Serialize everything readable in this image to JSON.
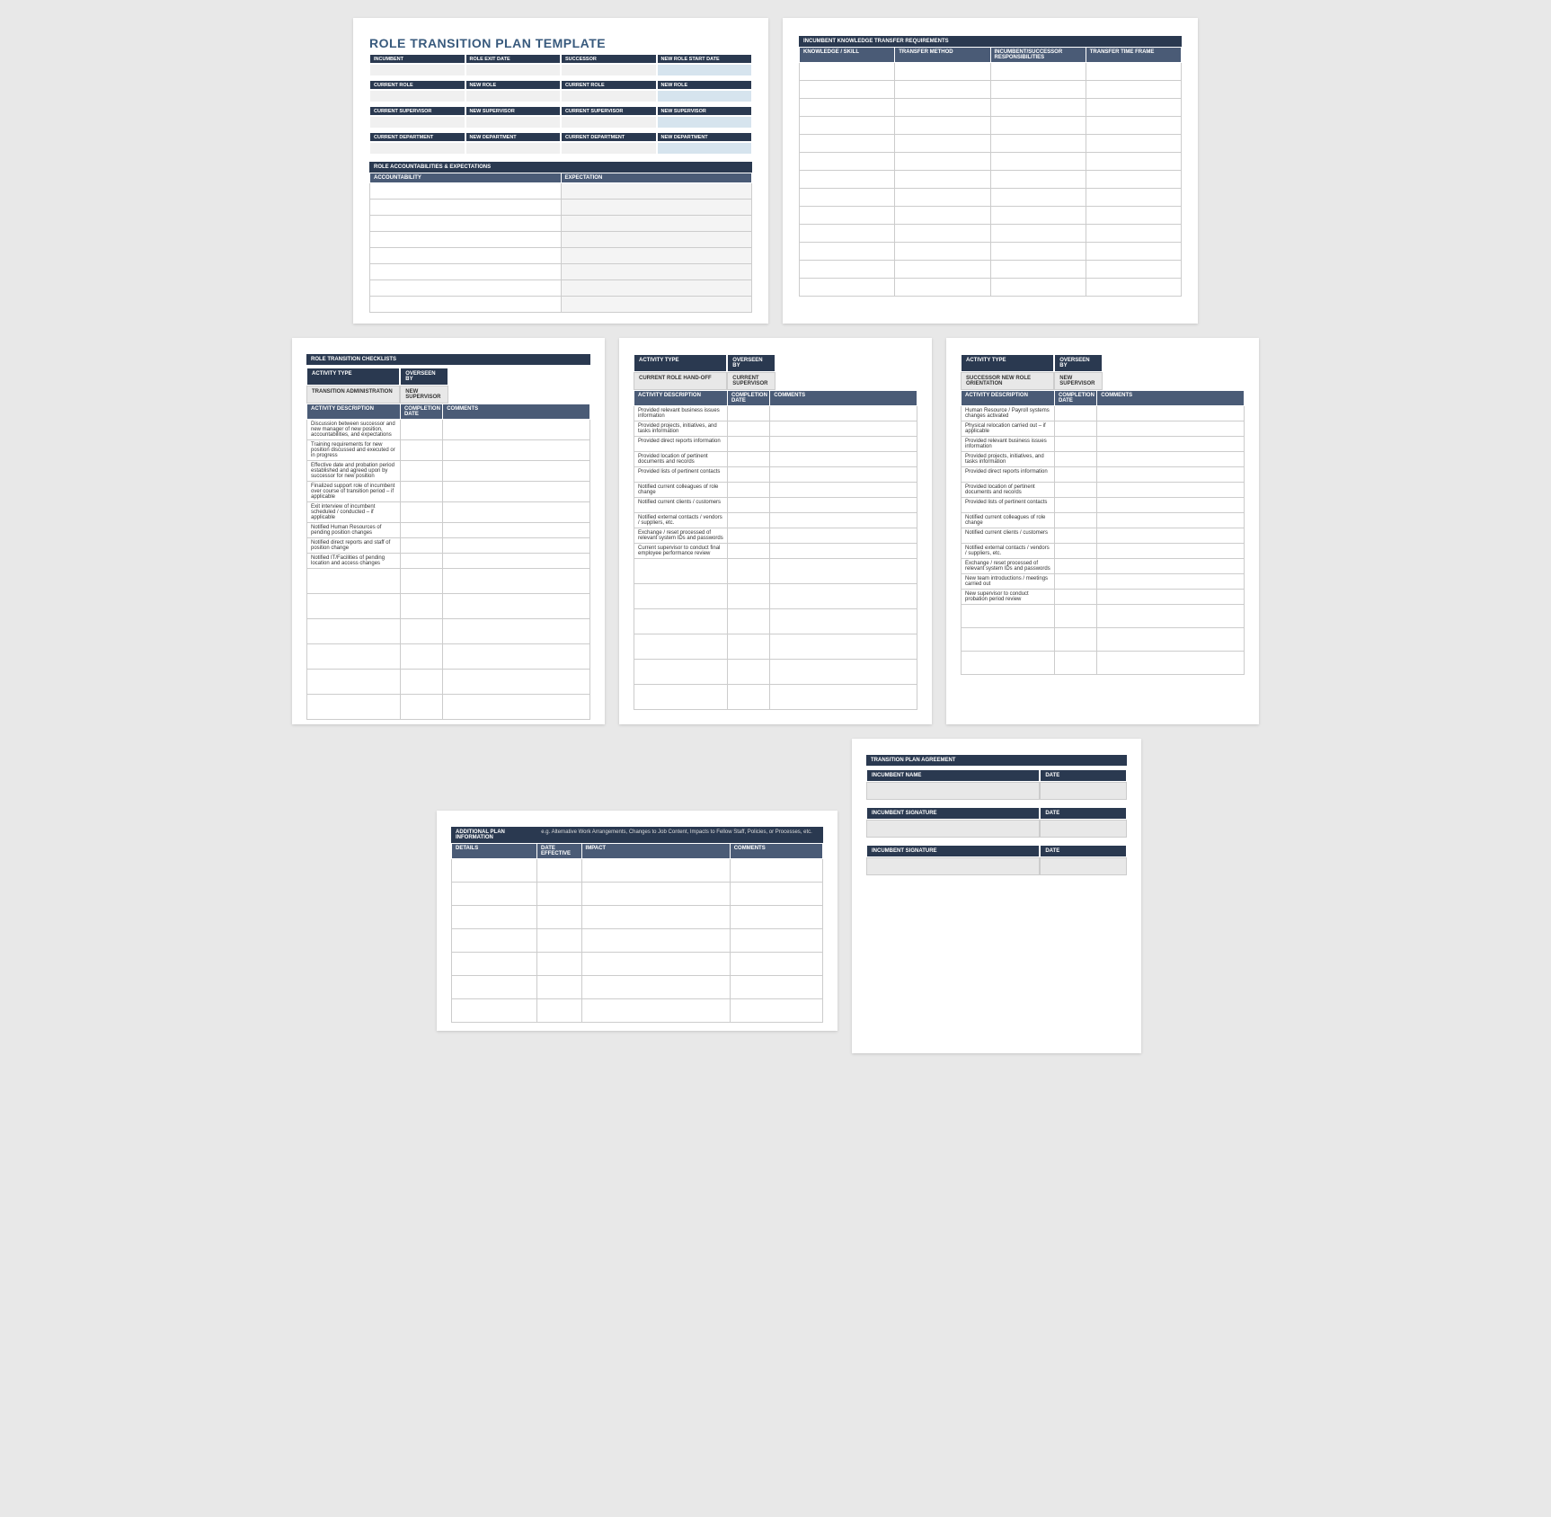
{
  "page1": {
    "title": "ROLE TRANSITION PLAN TEMPLATE",
    "r1": [
      "INCUMBENT",
      "ROLE EXIT DATE",
      "SUCCESSOR",
      "NEW ROLE START DATE"
    ],
    "r2": [
      "CURRENT ROLE",
      "NEW ROLE",
      "CURRENT ROLE",
      "NEW ROLE"
    ],
    "r3": [
      "CURRENT SUPERVISOR",
      "NEW SUPERVISOR",
      "CURRENT SUPERVISOR",
      "NEW SUPERVISOR"
    ],
    "r4": [
      "CURRENT DEPARTMENT",
      "NEW DEPARTMENT",
      "CURRENT DEPARTMENT",
      "NEW DEPARTMENT"
    ],
    "section": "ROLE ACCOUNTABILITIES & EXPECTATIONS",
    "cols": [
      "ACCOUNTABILITY",
      "EXPECTATION"
    ]
  },
  "page2": {
    "section": "INCUMBENT KNOWLEDGE TRANSFER REQUIREMENTS",
    "cols": [
      "KNOWLEDGE / SKILL",
      "TRANSFER METHOD",
      "INCUMBENT/SUCCESSOR RESPONSIBILITIES",
      "TRANSFER TIME FRAME"
    ]
  },
  "page3": {
    "title": "ROLE TRANSITION CHECKLISTS",
    "at": "ACTIVITY TYPE",
    "ob": "OVERSEEN BY",
    "sub1": "TRANSITION ADMINISTRATION",
    "sub2": "NEW SUPERVISOR",
    "cols": [
      "ACTIVITY DESCRIPTION",
      "COMPLETION DATE",
      "COMMENTS"
    ],
    "items": [
      "Discussion between successor and new manager of new position, accountabilities, and expectations",
      "Training requirements for new position discussed and executed or in progress",
      "Effective date and probation period established and agreed upon by successor for new position",
      "Finalized support role of incumbent over course of transition period – if applicable",
      "Exit interview of incumbent scheduled / conducted – if applicable",
      "Notified Human Resources of pending position changes",
      "Notified direct reports and staff of position change",
      "Notified IT/Facilities of pending location and access changes"
    ]
  },
  "page4": {
    "at": "ACTIVITY TYPE",
    "ob": "OVERSEEN BY",
    "sub1": "CURRENT ROLE HAND-OFF",
    "sub2": "CURRENT SUPERVISOR",
    "cols": [
      "ACTIVITY DESCRIPTION",
      "COMPLETION DATE",
      "COMMENTS"
    ],
    "items": [
      "Provided relevant business issues information",
      "Provided projects, initiatives, and tasks information",
      "Provided direct reports information",
      "Provided location of pertinent documents and records",
      "Provided lists of pertinent contacts",
      "Notified current colleagues of role change",
      "Notified current clients / customers",
      "Notified external contacts / vendors / suppliers, etc.",
      "Exchange / reset processed of relevant system IDs and passwords",
      "Current supervisor to conduct final employee performance review"
    ]
  },
  "page5": {
    "at": "ACTIVITY TYPE",
    "ob": "OVERSEEN BY",
    "sub1": "SUCCESSOR NEW ROLE ORIENTATION",
    "sub2": "NEW SUPERVISOR",
    "cols": [
      "ACTIVITY DESCRIPTION",
      "COMPLETION DATE",
      "COMMENTS"
    ],
    "items": [
      "Human Resource / Payroll systems changes activated",
      "Physical relocation carried out – if applicable",
      "Provided relevant business issues information",
      "Provided projects, initiatives, and tasks information",
      "Provided direct reports information",
      "Provided location of pertinent documents and records",
      "Provided lists of pertinent contacts",
      "Notified current colleagues of role change",
      "Notified current clients / customers",
      "Notified external contacts / vendors / suppliers, etc.",
      "Exchange / reset processed of relevant system IDs and passwords",
      "New team introductions / meetings carried out",
      "New supervisor to conduct probation period review"
    ]
  },
  "page6": {
    "section": "ADDITIONAL PLAN INFORMATION",
    "hint": "e.g. Alternative Work Arrangements, Changes to Job Content, Impacts to Fellow Staff, Policies, or Processes, etc.",
    "cols": [
      "DETAILS",
      "DATE EFFECTIVE",
      "IMPACT",
      "COMMENTS"
    ]
  },
  "page7": {
    "section": "TRANSITION PLAN AGREEMENT",
    "name": "INCUMBENT NAME",
    "date": "DATE",
    "sig": "INCUMBENT SIGNATURE"
  }
}
